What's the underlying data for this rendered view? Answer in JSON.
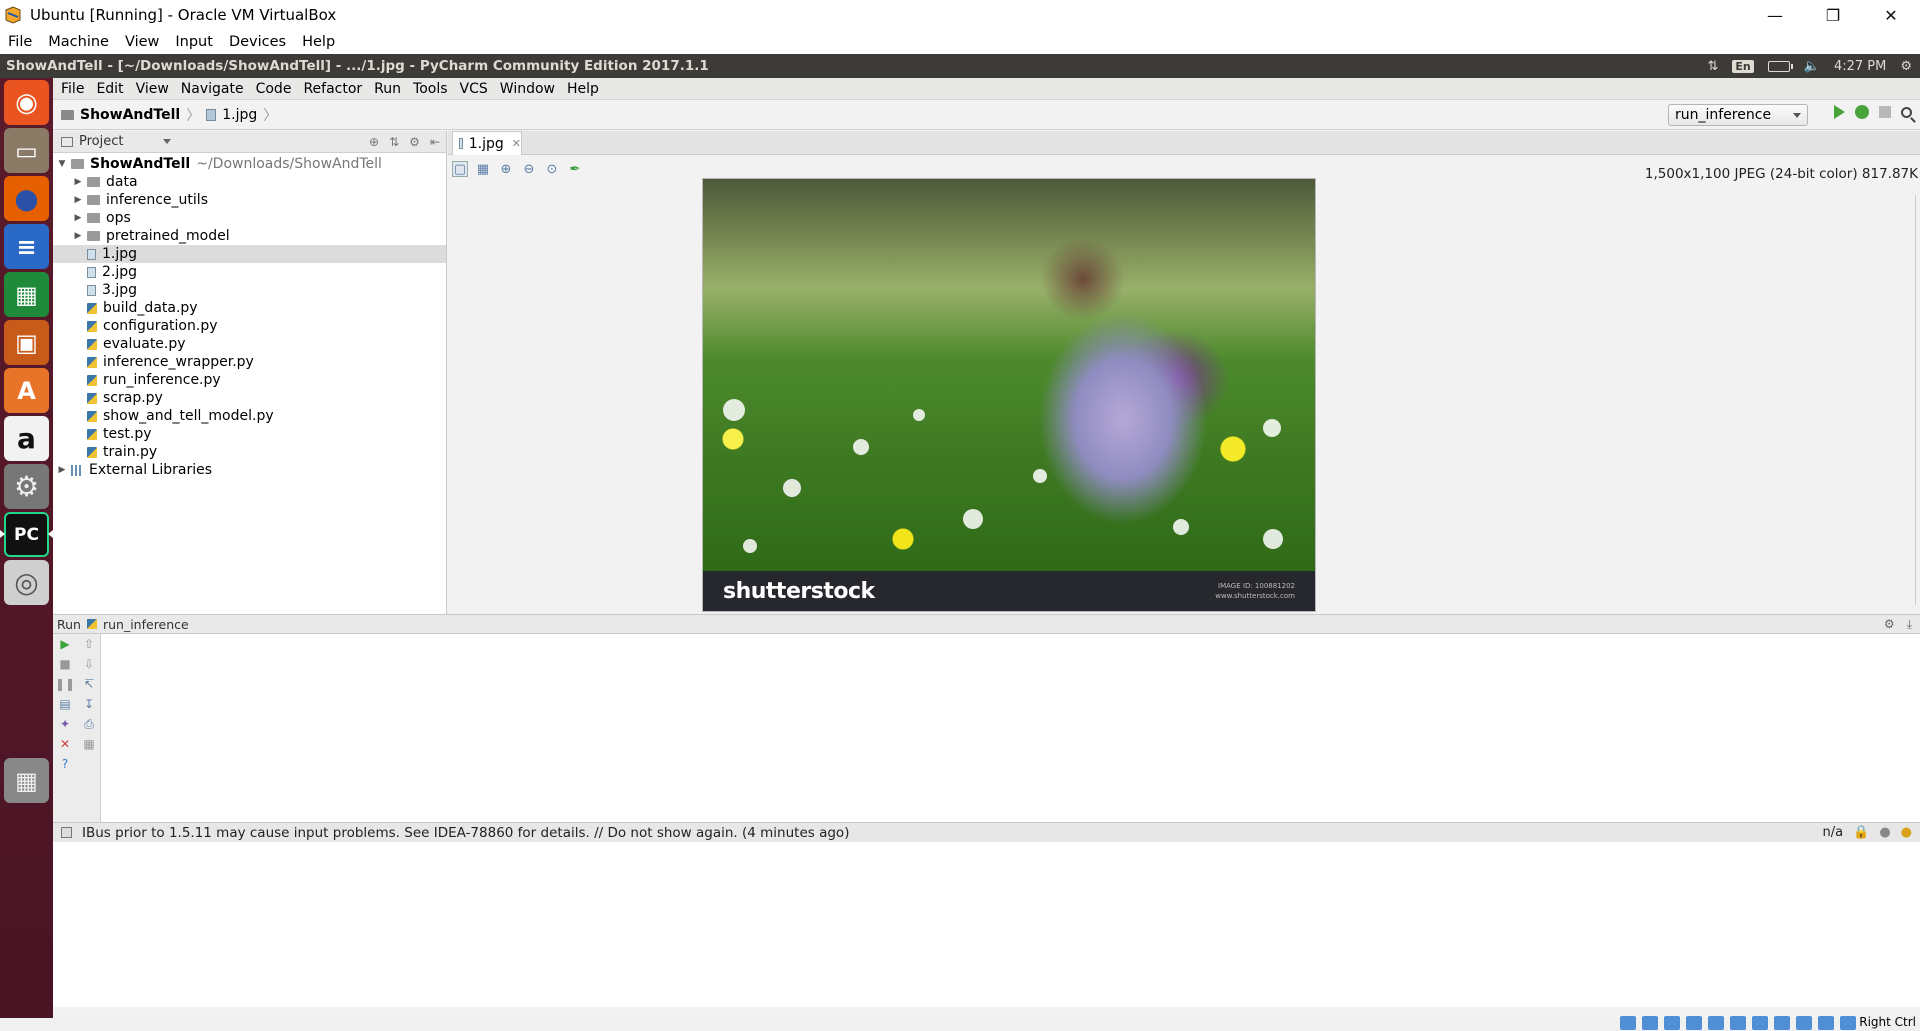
{
  "vbox": {
    "title": "Ubuntu [Running] - Oracle VM VirtualBox",
    "menu": [
      "File",
      "Machine",
      "View",
      "Input",
      "Devices",
      "Help"
    ],
    "host_key": "Right Ctrl"
  },
  "ubuntu": {
    "topbar_title": "ShowAndTell - [~/Downloads/ShowAndTell] - .../1.jpg - PyCharm Community Edition 2017.1.1",
    "keyboard": "En",
    "clock": "4:27 PM"
  },
  "launcher": [
    {
      "name": "ubuntu-dash",
      "glyph": "◉",
      "bg": "#e95420"
    },
    {
      "name": "files",
      "glyph": "▭",
      "bg": "#8a7a66"
    },
    {
      "name": "firefox",
      "glyph": "●",
      "bg": "#e66000"
    },
    {
      "name": "libreoffice-writer",
      "glyph": "≡",
      "bg": "#2a6ac6"
    },
    {
      "name": "libreoffice-calc",
      "glyph": "▦",
      "bg": "#1e8a3a"
    },
    {
      "name": "libreoffice-impress",
      "glyph": "▣",
      "bg": "#c85a1a"
    },
    {
      "name": "software-center",
      "glyph": "A",
      "bg": "#e8742a"
    },
    {
      "name": "amazon",
      "glyph": "a",
      "bg": "#f2f2f2"
    },
    {
      "name": "system-settings",
      "glyph": "⚙",
      "bg": "#777"
    },
    {
      "name": "pycharm",
      "glyph": "PC",
      "bg": "#111"
    },
    {
      "name": "dvd",
      "glyph": "◎",
      "bg": "#cfcfcf"
    },
    {
      "name": "trash",
      "glyph": "🗑",
      "bg": "#888"
    }
  ],
  "pycharm": {
    "menu": [
      "File",
      "Edit",
      "View",
      "Navigate",
      "Code",
      "Refactor",
      "Run",
      "Tools",
      "VCS",
      "Window",
      "Help"
    ],
    "breadcrumb": [
      "ShowAndTell",
      "1.jpg"
    ],
    "run_config": "run_inference",
    "project_panel_title": "Project",
    "tree_root": {
      "name": "ShowAndTell",
      "path": "~/Downloads/ShowAndTell"
    },
    "tree": [
      {
        "label": "data",
        "kind": "folder"
      },
      {
        "label": "inference_utils",
        "kind": "folder"
      },
      {
        "label": "ops",
        "kind": "folder"
      },
      {
        "label": "pretrained_model",
        "kind": "folder"
      },
      {
        "label": "1.jpg",
        "kind": "image",
        "selected": true
      },
      {
        "label": "2.jpg",
        "kind": "image"
      },
      {
        "label": "3.jpg",
        "kind": "image"
      },
      {
        "label": "build_data.py",
        "kind": "python"
      },
      {
        "label": "configuration.py",
        "kind": "python"
      },
      {
        "label": "evaluate.py",
        "kind": "python"
      },
      {
        "label": "inference_wrapper.py",
        "kind": "python"
      },
      {
        "label": "run_inference.py",
        "kind": "python"
      },
      {
        "label": "scrap.py",
        "kind": "python"
      },
      {
        "label": "show_and_tell_model.py",
        "kind": "python"
      },
      {
        "label": "test.py",
        "kind": "python"
      },
      {
        "label": "train.py",
        "kind": "python"
      }
    ],
    "external_libraries": "External Libraries",
    "editor_tab": "1.jpg",
    "image_info": "1,500x1,100 JPEG (24-bit color) 817.87K",
    "image": {
      "watermark_logo": "shutterstock",
      "image_id": "IMAGE ID: 100881202",
      "site": "www.shutterstock.com"
    },
    "run_panel": {
      "label": "Run",
      "config": "run_inference"
    },
    "status_message": "IBus prior to 1.5.11 may cause input problems. See IDEA-78860 for details. // Do not show again. (4 minutes ago)",
    "status_right": "n/a"
  }
}
